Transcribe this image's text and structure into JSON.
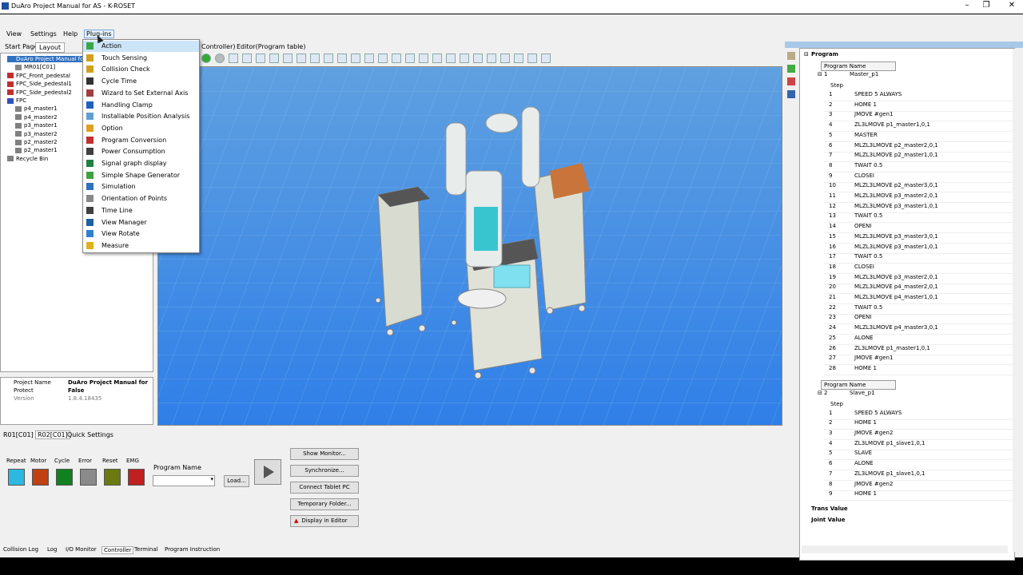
{
  "window": {
    "title": "DuAro Project Manual for AS - K-ROSET"
  },
  "menubar": {
    "view": "View",
    "settings": "Settings",
    "help": "Help",
    "plugins": "Plug-ins"
  },
  "left_tabs": {
    "start_page": "Start Page",
    "layout": "Layout"
  },
  "editor_tabs": {
    "controller": "Controller)",
    "editor": "Editor(Program table)"
  },
  "tree": [
    {
      "label": "DuAro Project Manual fo",
      "icon": "robot-icon",
      "color": "#3070c0"
    },
    {
      "label": "MR01[C01]",
      "icon": "robot-icon",
      "color": "#888888"
    },
    {
      "label": "FPC_Front_pedestal",
      "icon": "part-icon",
      "color": "#c03030"
    },
    {
      "label": "FPC_Side_pedestal1",
      "icon": "part-icon",
      "color": "#c03030"
    },
    {
      "label": "FPC_Side_pedestal2",
      "icon": "part-icon",
      "color": "#c03030"
    },
    {
      "label": "FPC",
      "icon": "part-icon",
      "color": "#3050c0"
    },
    {
      "label": "p4_master1",
      "icon": "point-icon",
      "color": "#808080"
    },
    {
      "label": "p4_master2",
      "icon": "point-icon",
      "color": "#808080"
    },
    {
      "label": "p3_master1",
      "icon": "point-icon",
      "color": "#808080"
    },
    {
      "label": "p3_master2",
      "icon": "point-icon",
      "color": "#808080"
    },
    {
      "label": "p2_master2",
      "icon": "point-icon",
      "color": "#808080"
    },
    {
      "label": "p2_master1",
      "icon": "point-icon",
      "color": "#808080"
    },
    {
      "label": "Recycle Bin",
      "icon": "recycle-bin-icon",
      "color": "#808080"
    }
  ],
  "info": {
    "project_name_label": "Project Name",
    "project_name_value": "DuAro Project Manual for",
    "protect_label": "Protect",
    "protect_value": "False",
    "version_label": "Version",
    "version_value": "1.8.4.18435"
  },
  "plugins_menu": [
    {
      "label": "Action",
      "icon": "action-icon",
      "color": "#3aa64a"
    },
    {
      "label": "Touch Sensing",
      "icon": "touch-sensing-icon",
      "color": "#d0a020"
    },
    {
      "label": "Collision Check",
      "icon": "collision-check-icon",
      "color": "#d0a020"
    },
    {
      "label": "Cycle Time",
      "icon": "clock-icon",
      "color": "#333333"
    },
    {
      "label": "Wizard to Set External Axis",
      "icon": "wizard-icon",
      "color": "#a04040"
    },
    {
      "label": "Handling Clamp",
      "icon": "clamp-icon",
      "color": "#2060c0"
    },
    {
      "label": "Installable Position Analysis",
      "icon": "analysis-icon",
      "color": "#60a0d0"
    },
    {
      "label": "Option",
      "icon": "option-icon",
      "color": "#e0a020"
    },
    {
      "label": "Program Conversion",
      "icon": "conversion-icon",
      "color": "#c03030"
    },
    {
      "label": "Power Consumption",
      "icon": "power-icon",
      "color": "#404040"
    },
    {
      "label": "Signal graph display",
      "icon": "signal-graph-icon",
      "color": "#208040"
    },
    {
      "label": "Simple Shape Generator",
      "icon": "shape-icon",
      "color": "#40a040"
    },
    {
      "label": "Simulation",
      "icon": "simulation-icon",
      "color": "#3070c0"
    },
    {
      "label": "Orientation of Points",
      "icon": "orientation-icon",
      "color": "#888888"
    },
    {
      "label": "Time Line",
      "icon": "timeline-icon",
      "color": "#404040"
    },
    {
      "label": "View Manager",
      "icon": "view-manager-icon",
      "color": "#2060a0"
    },
    {
      "label": "View Rotate",
      "icon": "view-rotate-icon",
      "color": "#3080d0"
    },
    {
      "label": "Measure",
      "icon": "measure-icon",
      "color": "#e0b020"
    }
  ],
  "controller": {
    "tabs": [
      "R01[C01]",
      "R02[C01]",
      "Quick Settings"
    ],
    "lamps": [
      {
        "label": "Repeat",
        "color": "#2cb8e0"
      },
      {
        "label": "Motor",
        "color": "#c04010"
      },
      {
        "label": "Cycle",
        "color": "#108020"
      },
      {
        "label": "Error",
        "color": "#8a8a8a"
      },
      {
        "label": "Reset",
        "color": "#6a7a10"
      },
      {
        "label": "EMG",
        "color": "#c02020"
      }
    ],
    "program_name_label": "Program Name",
    "load_label": "Load...",
    "buttons": [
      "Show Monitor...",
      "Synchronize...",
      "Connect Tablet PC",
      "Temporary Folder...",
      "Display in Editor"
    ]
  },
  "bottom_tabs": [
    "Collision Log",
    "Log",
    "I/O Monitor",
    "Controller",
    "Terminal",
    "Program Instruction"
  ],
  "program_panel": {
    "title": "Program",
    "program_name_header": "Program Name",
    "step_header": "Step",
    "programs": [
      {
        "index": "1",
        "name": "Master_p1",
        "steps": [
          "SPEED 5 ALWAYS",
          "HOME 1",
          "JMOVE #gen1",
          "ZL3LMOVE p1_master1,0,1",
          "MASTER",
          "MLZL3LMOVE p2_master2,0,1",
          "MLZL3LMOVE p2_master1,0,1",
          "TWAIT 0.5",
          "CLOSEI",
          "MLZL3LMOVE p2_master3,0,1",
          "MLZL3LMOVE p3_master2,0,1",
          "MLZL3LMOVE p3_master1,0,1",
          "TWAIT 0.5",
          "OPENI",
          "MLZL3LMOVE p3_master3,0,1",
          "MLZL3LMOVE p3_master1,0,1",
          "TWAIT 0.5",
          "CLOSEI",
          "MLZL3LMOVE p3_master2,0,1",
          "MLZL3LMOVE p4_master2,0,1",
          "MLZL3LMOVE p4_master1,0,1",
          "TWAIT 0.5",
          "OPENI",
          "MLZL3LMOVE p4_master3,0,1",
          "ALONE",
          "ZL3LMOVE p1_master1,0,1",
          "JMOVE #gen1",
          "HOME 1"
        ]
      },
      {
        "index": "2",
        "name": "Slave_p1",
        "steps": [
          "SPEED 5 ALWAYS",
          "HOME 1",
          "JMOVE #gen2",
          "ZL3LMOVE p1_slave1,0,1",
          "SLAVE",
          "ALONE",
          "ZL3LMOVE p1_slave1,0,1",
          "JMOVE #gen2",
          "HOME 1"
        ]
      }
    ],
    "trans_value": "Trans Value",
    "joint_value": "Joint Value"
  }
}
